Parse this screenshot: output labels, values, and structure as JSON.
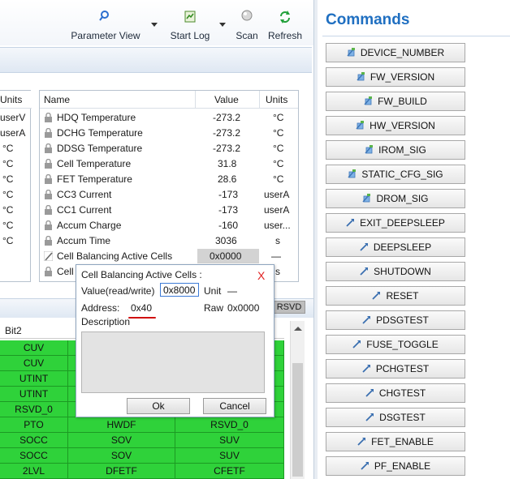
{
  "toolbar": {
    "parameter_view_label": "Parameter View",
    "start_log_label": "Start Log",
    "scan_label": "Scan",
    "refresh_label": "Refresh"
  },
  "left_units": {
    "header": "Units",
    "values": [
      "userV",
      "userA",
      "°C",
      "°C",
      "°C",
      "°C",
      "°C",
      "°C",
      "°C"
    ]
  },
  "registers": {
    "headers": {
      "name": "Name",
      "value": "Value",
      "units": "Units"
    },
    "rows": [
      {
        "name": "HDQ Temperature",
        "value": "-273.2",
        "units": "°C"
      },
      {
        "name": "DCHG Temperature",
        "value": "-273.2",
        "units": "°C"
      },
      {
        "name": "DDSG Temperature",
        "value": "-273.2",
        "units": "°C"
      },
      {
        "name": "Cell Temperature",
        "value": "31.8",
        "units": "°C"
      },
      {
        "name": "FET Temperature",
        "value": "28.6",
        "units": "°C"
      },
      {
        "name": "CC3 Current",
        "value": "-173",
        "units": "userA"
      },
      {
        "name": "CC1 Current",
        "value": "-173",
        "units": "userA"
      },
      {
        "name": "Accum Charge",
        "value": "-160",
        "units": "user..."
      },
      {
        "name": "Accum Time",
        "value": "3036",
        "units": "s"
      },
      {
        "name": "Cell Balancing Active Cells",
        "value": "0x0000",
        "units": "—"
      },
      {
        "name": "Cell",
        "value": "",
        "units": "s"
      }
    ]
  },
  "bit_table": {
    "rsvd_tag": "RSVD",
    "header_bit2": "Bit2",
    "rows": [
      [
        "CUV",
        "",
        ""
      ],
      [
        "CUV",
        "",
        ""
      ],
      [
        "UTINT",
        "",
        ""
      ],
      [
        "UTINT",
        "",
        ""
      ],
      [
        "RSVD_0",
        "",
        ""
      ],
      [
        "PTO",
        "HWDF",
        "RSVD_0"
      ],
      [
        "SOCC",
        "SOV",
        "SUV"
      ],
      [
        "SOCC",
        "SOV",
        "SUV"
      ],
      [
        "2LVL",
        "DFETF",
        "CFETF"
      ]
    ]
  },
  "dialog": {
    "title": "Cell Balancing Active Cells :",
    "value_label": "Value(read/write)",
    "value": "0x8000",
    "unit_label": "Unit",
    "unit_value": "—",
    "address_label": "Address:",
    "address_value": "0x40",
    "raw_label": "Raw",
    "raw_value": "0x0000",
    "description_label": "Description",
    "ok_label": "Ok",
    "cancel_label": "Cancel",
    "close_glyph": "X"
  },
  "commands": {
    "title": "Commands",
    "items": [
      {
        "label": "DEVICE_NUMBER",
        "icon": "read-icon"
      },
      {
        "label": "FW_VERSION",
        "icon": "read-icon"
      },
      {
        "label": "FW_BUILD",
        "icon": "read-icon"
      },
      {
        "label": "HW_VERSION",
        "icon": "read-icon"
      },
      {
        "label": "IROM_SIG",
        "icon": "read-icon"
      },
      {
        "label": "STATIC_CFG_SIG",
        "icon": "read-icon"
      },
      {
        "label": "DROM_SIG",
        "icon": "read-icon"
      },
      {
        "label": "EXIT_DEEPSLEEP",
        "icon": "send-icon"
      },
      {
        "label": "DEEPSLEEP",
        "icon": "send-icon"
      },
      {
        "label": "SHUTDOWN",
        "icon": "send-icon"
      },
      {
        "label": "RESET",
        "icon": "send-icon"
      },
      {
        "label": "PDSGTEST",
        "icon": "send-icon"
      },
      {
        "label": "FUSE_TOGGLE",
        "icon": "send-icon"
      },
      {
        "label": "PCHGTEST",
        "icon": "send-icon"
      },
      {
        "label": "CHGTEST",
        "icon": "send-icon"
      },
      {
        "label": "DSGTEST",
        "icon": "send-icon"
      },
      {
        "label": "FET_ENABLE",
        "icon": "send-icon"
      },
      {
        "label": "PF_ENABLE",
        "icon": "send-icon"
      }
    ]
  },
  "colors": {
    "accent_blue": "#1f6fc1",
    "bit_set_green": "#2fd23a",
    "close_red": "#e02020"
  }
}
